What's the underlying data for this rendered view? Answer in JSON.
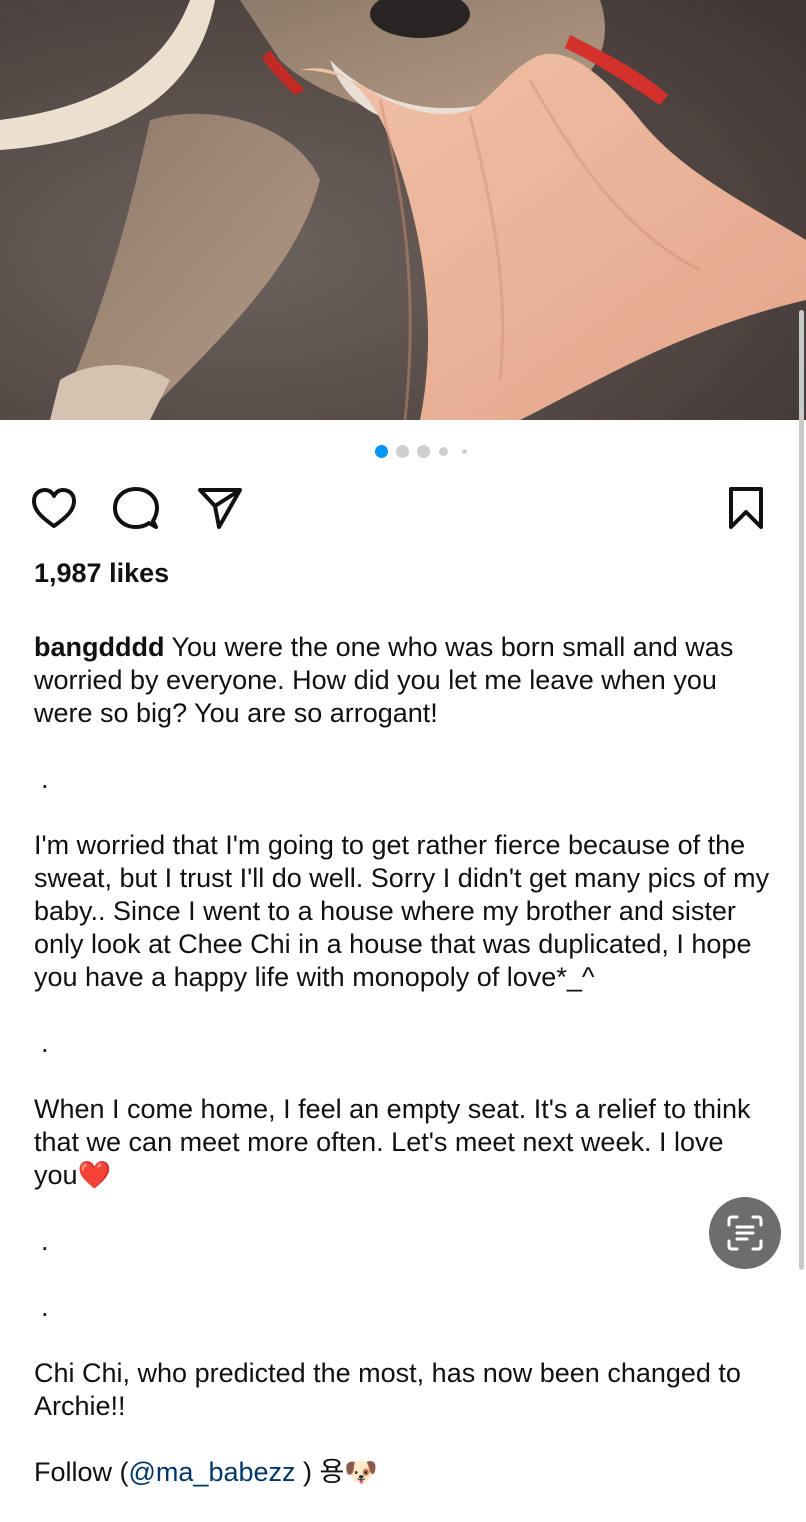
{
  "post": {
    "likes": "1,987 likes",
    "carousel": {
      "total": 5,
      "active": 1
    }
  },
  "caption": {
    "username": "bangdddd",
    "line1": " You were the one who was born small and was worried by everyone. How did you let me leave when you were so big? You are so arrogant!",
    "dot": ".",
    "para2": "I'm worried that I'm going to get rather fierce because of the sweat, but I trust I'll do well. Sorry I didn't get many pics of my baby.. Since I went to a house where my brother and sister only look at Chee Chi in a house that was duplicated, I hope you have a happy life with monopoly of love*_^",
    "para3": "When I come home, I feel an empty seat. It's a relief to think that we can meet more often. Let's meet next week. I love you",
    "heart": "❤️",
    "para4": "Chi Chi, who predicted the most, has now been changed to Archie!!",
    "follow_prefix": "Follow (",
    "mention": "@ma_babezz",
    "follow_suffix": " ) 용",
    "emoji": "🐶"
  },
  "icons": {
    "like": "heart-icon",
    "comment": "comment-icon",
    "share": "paper-plane-icon",
    "save": "bookmark-icon",
    "live_text": "live-text-icon"
  },
  "colors": {
    "accent": "#0095f6",
    "text": "#111111",
    "mention": "#00376b",
    "heart": "#e0245e"
  }
}
